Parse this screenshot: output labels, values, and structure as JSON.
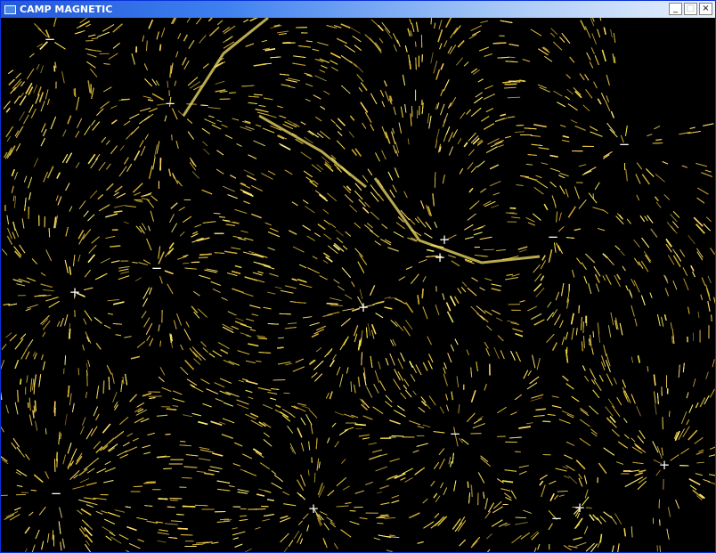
{
  "window": {
    "title": "CAMP MAGNETIC",
    "controls": [
      {
        "name": "minimize-button",
        "glyph": "_"
      },
      {
        "name": "maximize-button",
        "glyph": "□"
      },
      {
        "name": "close-button",
        "glyph": "×"
      }
    ]
  },
  "field": {
    "background": "#000000",
    "stroke_colors": [
      "#f5e04a",
      "#e8c53a",
      "#fff07a",
      "#d8b43a",
      "#ffd76a",
      "#c9a531"
    ],
    "marker_color": "#ffffff",
    "charges": [
      {
        "sign": "-",
        "label": "−"
      },
      {
        "sign": "-",
        "label": "−"
      },
      {
        "sign": "-",
        "label": "−"
      },
      {
        "sign": "-",
        "label": "−"
      },
      {
        "sign": "-",
        "label": "−"
      },
      {
        "sign": "+",
        "label": "+"
      },
      {
        "sign": "+",
        "label": "+"
      },
      {
        "sign": "+",
        "label": "+"
      },
      {
        "sign": "+",
        "label": "+"
      },
      {
        "sign": "-",
        "label": "−"
      },
      {
        "sign": "-",
        "label": "−"
      },
      {
        "sign": "+",
        "label": "+"
      },
      {
        "sign": "+",
        "label": "+"
      },
      {
        "sign": "-",
        "label": "−"
      },
      {
        "sign": "+",
        "label": "+"
      }
    ]
  }
}
